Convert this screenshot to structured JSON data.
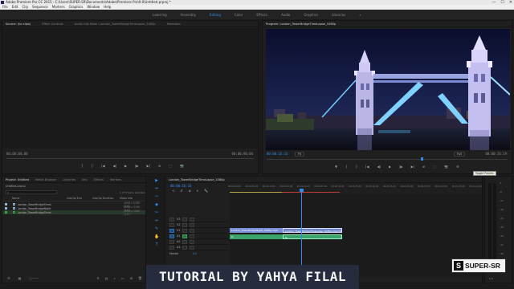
{
  "window": {
    "title": "Adobe Premiere Pro CC 2015 - C:\\Users\\SUPER-SR\\Documents\\Adobe\\Premiere Pro\\9.0\\Untitled.prproj *",
    "min_glyph": "—",
    "max_glyph": "☐",
    "close_glyph": "✕"
  },
  "menu": [
    "File",
    "Edit",
    "Clip",
    "Sequence",
    "Markers",
    "Graphics",
    "Window",
    "Help"
  ],
  "workspaces": {
    "items": [
      "Learning",
      "Assembly",
      "Editing",
      "Color",
      "Effects",
      "Audio",
      "Graphics",
      "Libraries"
    ],
    "active": "Editing",
    "more": "»"
  },
  "source_panel": {
    "tabs": [
      "Source: (no clips)",
      "Effect Controls",
      "Audio Clip Mixer: London_TowerBridgeTimeLapse_1080p",
      "Metadata"
    ],
    "timecode_left": "00;00;00;00",
    "timecode_right": "00;00;00;00",
    "page_ctl": "Page 1",
    "controls": [
      "{",
      "}",
      "|◀",
      "◀|",
      "▶",
      "|▶",
      "▶|",
      "⊕",
      "⬚",
      "📷"
    ]
  },
  "program_panel": {
    "tab": "Program: London_TowerBridgeTimeLapse_1080p",
    "timecode_left": "00:00:16:16",
    "fit": "Fit",
    "quality": "Full",
    "timecode_right": "00:00:26:19",
    "controls": [
      "▼",
      "{",
      "}",
      "|◀",
      "◀|",
      "▶",
      "|▶",
      "▶|",
      "⊕",
      "⬚",
      "📷",
      "⚙"
    ],
    "tooltip": "Toggle Proxies"
  },
  "project_panel": {
    "tabs": [
      "Project: Untitled",
      "Media Browser",
      "Libraries",
      "Info",
      "Effects",
      "Markers"
    ],
    "project_name": "Untitled.prproj",
    "search_placeholder": "",
    "item_count": "1 of 3 items selected",
    "columns": [
      "Name",
      "Subclip End",
      "Subclip Duration",
      "Video Info"
    ],
    "items": [
      {
        "name": "London_TowerBridgeTimeL",
        "info": "4096 x 2160 (1.0)",
        "color": "#8fb8d9"
      },
      {
        "name": "London_TowerBridgeNight",
        "info": "4096 x 2160 (1.0)",
        "color": "#8fb8d9"
      },
      {
        "name": "London_TowerBridgeTimeL",
        "info": "1920 x 1080 (1.0)",
        "color": "#39a056"
      }
    ]
  },
  "timeline_panel": {
    "tab": "London_TowerBridgeTimeLapse_1080p",
    "timecode": "00:00:16:16",
    "ruler": [
      "00:00:00:00",
      "00:00:05:00",
      "00:00:10:00",
      "00:00:15:00",
      "00:00:20:00",
      "00:00:25:00",
      "00:00:30:00",
      "00:00:35:00",
      "00:00:40:00",
      "00:00:45:00",
      "00:00:50:00",
      "00:00:55:00",
      "00:01:00:00",
      "00:01:05:00",
      "00:01:10:00"
    ],
    "tracks": [
      {
        "label": "V3",
        "type": "video"
      },
      {
        "label": "V2",
        "type": "video"
      },
      {
        "label": "V1",
        "type": "video",
        "active": true
      },
      {
        "label": "A1",
        "type": "audio",
        "active": true
      },
      {
        "label": "A2",
        "type": "audio"
      },
      {
        "label": "A3",
        "type": "audio"
      }
    ],
    "master_label": "Master",
    "master_value": "0.0",
    "clips": {
      "video_a": "London_TowerBridgeNight_1080p.mp4",
      "video_b": "London_TowerBridgeTimeLapse_1080p.mp4 [V]",
      "audio_a": "fx",
      "audio_b": "fx"
    },
    "tools": [
      "▶",
      "⇹",
      "⇿",
      "◆",
      "✂",
      "⇔",
      "✎",
      "✋",
      "T"
    ],
    "timeline_buttons": [
      "⟲",
      "⇵",
      "◈",
      "⌖",
      "🔧"
    ]
  },
  "audio_meter": {
    "scale": [
      "0",
      "-6",
      "-12",
      "-18",
      "-24",
      "-30",
      "-36",
      "-42",
      "-48",
      "-54",
      "dB"
    ],
    "sr": "S R"
  },
  "overlay": {
    "banner": "TUTORIAL BY YAHYA FILAL",
    "logo_mark": "S",
    "logo_text": "SUPER-SR"
  },
  "colors": {
    "accent_blue": "#2d8ceb",
    "label_green": "#39a056",
    "clip_video": "#7b8fd6",
    "clip_video_b": "#6e86c9",
    "clip_audio": "#3ca36a",
    "workarea_red": "#c23a3a",
    "workarea_yellow": "#b8a84a"
  }
}
